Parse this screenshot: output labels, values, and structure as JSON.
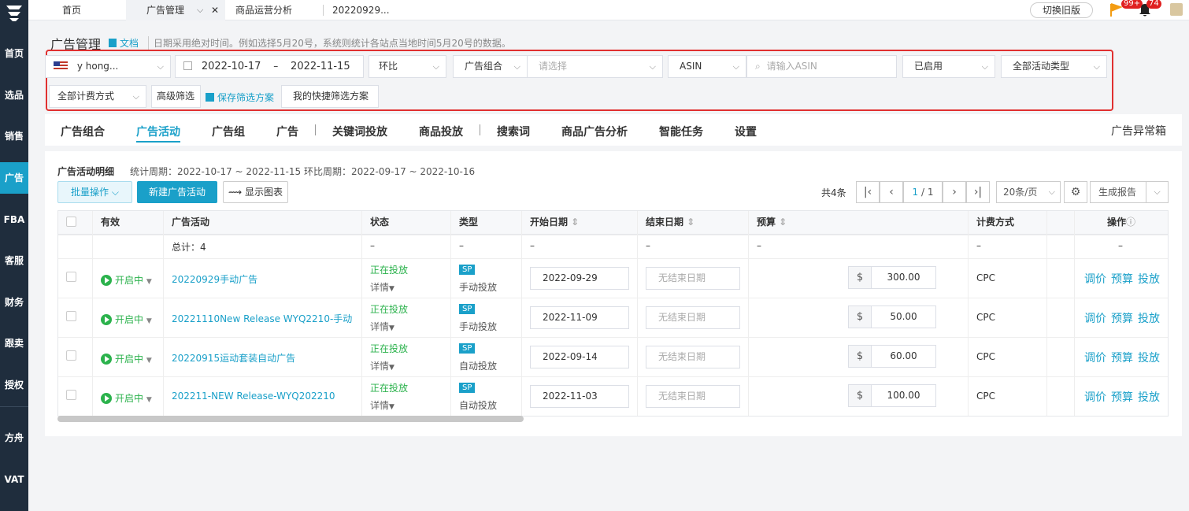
{
  "sidebar": {
    "items": [
      {
        "label": "首页"
      },
      {
        "label": "选品"
      },
      {
        "label": "销售"
      },
      {
        "label": "广告"
      },
      {
        "label": "FBA"
      },
      {
        "label": "客服"
      },
      {
        "label": "财务"
      },
      {
        "label": "跟卖"
      },
      {
        "label": "授权"
      },
      {
        "label": "方舟"
      },
      {
        "label": "VAT"
      }
    ]
  },
  "topbar": {
    "tabs": [
      {
        "label": "首页"
      },
      {
        "label": "广告管理"
      },
      {
        "label": "商品运营分析"
      },
      {
        "label": "20220929..."
      }
    ],
    "switch_old": "切换旧版",
    "flag_badge": "99+",
    "bell_badge": "74"
  },
  "header": {
    "title": "广告管理",
    "doc_link": "文档",
    "note": "日期采用绝对时间。例如选择5月20号，系统则统计各站点当地时间5月20号的数据。"
  },
  "filters": {
    "store": "y hong...",
    "date_start": "2022-10-17",
    "date_sep": "–",
    "date_end": "2022-11-15",
    "compare": "环比",
    "portfolio_label": "广告组合",
    "portfolio_placeholder": "请选择",
    "asin_type": "ASIN",
    "asin_placeholder": "请输入ASIN",
    "enabled": "已启用",
    "campaign_type": "全部活动类型",
    "billing": "全部计费方式",
    "advanced": "高级筛选",
    "save_scheme": "保存筛选方案",
    "my_scheme": "我的快捷筛选方案"
  },
  "main_tabs": [
    {
      "label": "广告组合"
    },
    {
      "label": "广告活动"
    },
    {
      "label": "广告组"
    },
    {
      "label": "广告"
    },
    {
      "label": "关键词投放"
    },
    {
      "label": "商品投放"
    },
    {
      "label": "搜索词"
    },
    {
      "label": "商品广告分析"
    },
    {
      "label": "智能任务"
    },
    {
      "label": "设置"
    }
  ],
  "anomaly_box": "广告异常箱",
  "detail": {
    "title": "广告活动明细",
    "period": "统计周期：2022-10-17 ~ 2022-11-15 环比周期：2022-09-17 ~ 2022-10-16",
    "batch": "批量操作",
    "new_campaign": "新建广告活动",
    "show_chart": "显示图表",
    "total": "共4条",
    "page_current": "1",
    "page_total": "/ 1",
    "page_size": "20条/页",
    "report": "生成报告"
  },
  "table": {
    "headers": [
      "有效",
      "广告活动",
      "状态",
      "类型",
      "开始日期",
      "结束日期",
      "预算",
      "计费方式",
      "操作"
    ],
    "total_row": {
      "label": "总计：4",
      "dash": "–"
    },
    "rows": [
      {
        "status": "开启中",
        "name": "20220929手动广告",
        "state": "正在投放",
        "detail": "详情",
        "tag": "SP",
        "type": "手动投放",
        "start": "2022-09-29",
        "end_placeholder": "无结束日期",
        "currency": "$",
        "budget": "300.00",
        "billing": "CPC"
      },
      {
        "status": "开启中",
        "name": "20221110New Release WYQ2210-手动",
        "state": "正在投放",
        "detail": "详情",
        "tag": "SP",
        "type": "手动投放",
        "start": "2022-11-09",
        "end_placeholder": "无结束日期",
        "currency": "$",
        "budget": "50.00",
        "billing": "CPC"
      },
      {
        "status": "开启中",
        "name": "20220915运动套装自动广告",
        "state": "正在投放",
        "detail": "详情",
        "tag": "SP",
        "type": "自动投放",
        "start": "2022-09-14",
        "end_placeholder": "无结束日期",
        "currency": "$",
        "budget": "60.00",
        "billing": "CPC"
      },
      {
        "status": "开启中",
        "name": "202211-NEW Release-WYQ202210",
        "state": "正在投放",
        "detail": "详情",
        "tag": "SP",
        "type": "自动投放",
        "start": "2022-11-03",
        "end_placeholder": "无结束日期",
        "currency": "$",
        "budget": "100.00",
        "billing": "CPC"
      }
    ],
    "ops": {
      "bid": "调价",
      "budget": "预算",
      "deliver": "投放"
    }
  },
  "colors": {
    "accent": "#1aa0c9",
    "sidebar": "#1f2d3d",
    "active_green": "#2bb24c",
    "highlight_border": "#e03030"
  }
}
